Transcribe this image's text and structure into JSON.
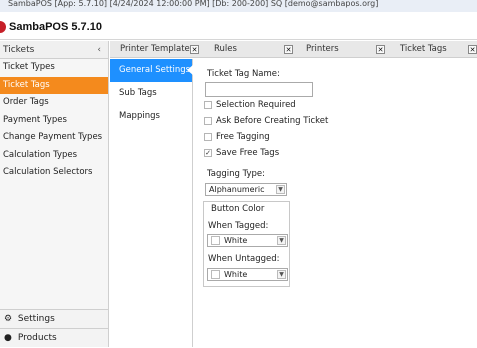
{
  "window": {
    "title": "SambaPOS [App: 5.7.10] [4/24/2024 12:00:00 PM] [Db: 200-200] SQ [demo@sambapos.org]"
  },
  "app": {
    "name": "SambaPOS 5.7.10",
    "brand_color": "#c61f28"
  },
  "sidebar": {
    "header": "Tickets",
    "collapse_icon": "chevron-left-icon",
    "active_color": "#f48a1d",
    "items": [
      {
        "label": "Ticket Types"
      },
      {
        "label": "Ticket Tags",
        "active": true
      },
      {
        "label": "Order Tags"
      },
      {
        "label": "Payment Types"
      },
      {
        "label": "Change Payment Types"
      },
      {
        "label": "Calculation Types"
      },
      {
        "label": "Calculation Selectors"
      }
    ],
    "bottom": [
      {
        "label": "Settings",
        "icon": "gear-icon"
      },
      {
        "label": "Products",
        "icon": "products-icon"
      }
    ]
  },
  "tabs": [
    {
      "label": "Printer Templates"
    },
    {
      "label": "Rules"
    },
    {
      "label": "Printers"
    },
    {
      "label": "Ticket Tags"
    }
  ],
  "subnav": {
    "active_color": "#1e90ff",
    "items": [
      {
        "label": "General Settings",
        "active": true
      },
      {
        "label": "Sub Tags"
      },
      {
        "label": "Mappings"
      }
    ]
  },
  "form": {
    "name_label": "Ticket Tag Name:",
    "name_value": "",
    "checkboxes": [
      {
        "label": "Selection Required",
        "checked": false
      },
      {
        "label": "Ask Before Creating Ticket",
        "checked": false
      },
      {
        "label": "Free Tagging",
        "checked": false
      },
      {
        "label": "Save Free Tags",
        "checked": true
      }
    ],
    "tagging_type_label": "Tagging Type:",
    "tagging_type_value": "Alphanumeric",
    "button_color_label": "Button Color",
    "when_tagged_label": "When Tagged:",
    "when_tagged_value": "White",
    "when_untagged_label": "When Untagged:",
    "when_untagged_value": "White"
  }
}
